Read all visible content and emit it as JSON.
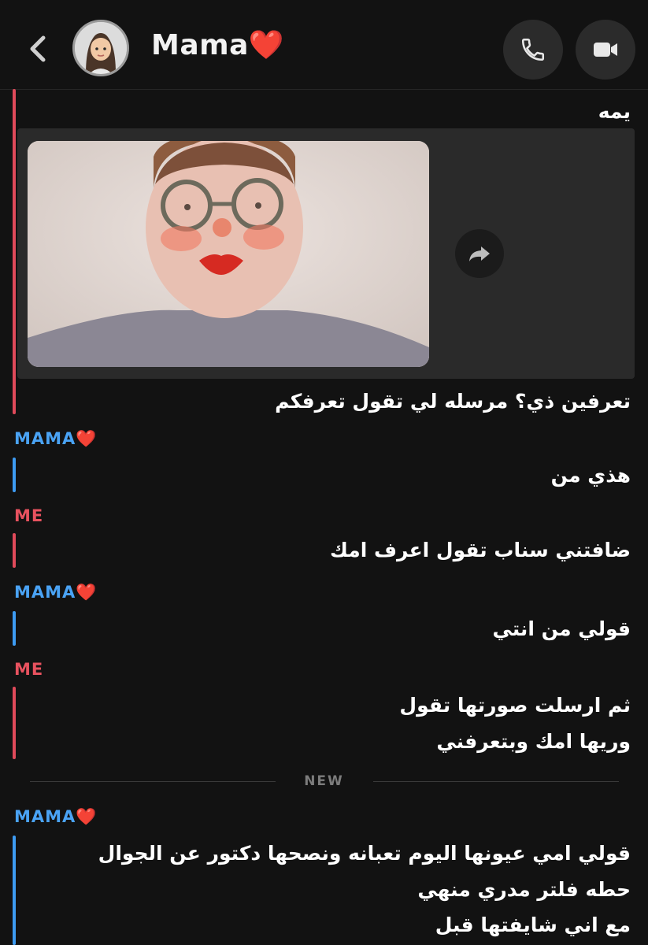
{
  "header": {
    "contact_name": "Mama❤️",
    "colors": {
      "background": "#121212",
      "button_bg": "#2b2b2b"
    },
    "icons": [
      "chevron-left-icon",
      "bitmoji-avatar",
      "phone-icon",
      "video-camera-icon"
    ]
  },
  "conversation": {
    "first_block": {
      "caption_top": "يمه",
      "caption_bottom": "تعرفين ذي؟ مرسله لي تقول تعرفكم"
    },
    "messages": [
      {
        "sender": "MAMA❤️",
        "text": "هذي من"
      },
      {
        "sender": "ME",
        "text": "ضافتني سناب تقول اعرف امك"
      },
      {
        "sender": "MAMA❤️",
        "text": "قولي من انتي"
      },
      {
        "sender": "ME",
        "lines": [
          "ثم ارسلت صورتها تقول",
          "وريها امك وبتعرفني"
        ]
      }
    ],
    "divider_label": "NEW",
    "last_message": {
      "sender": "MAMA❤️",
      "lines": [
        "قولي امي عيونها اليوم تعبانه ونصحها دكتور عن الجوال",
        "حطه فلتر مدري منهي",
        "مع اني شايفتها قبل"
      ]
    }
  },
  "colors": {
    "me": "#e04a5a",
    "mama": "#3d9bf2"
  }
}
